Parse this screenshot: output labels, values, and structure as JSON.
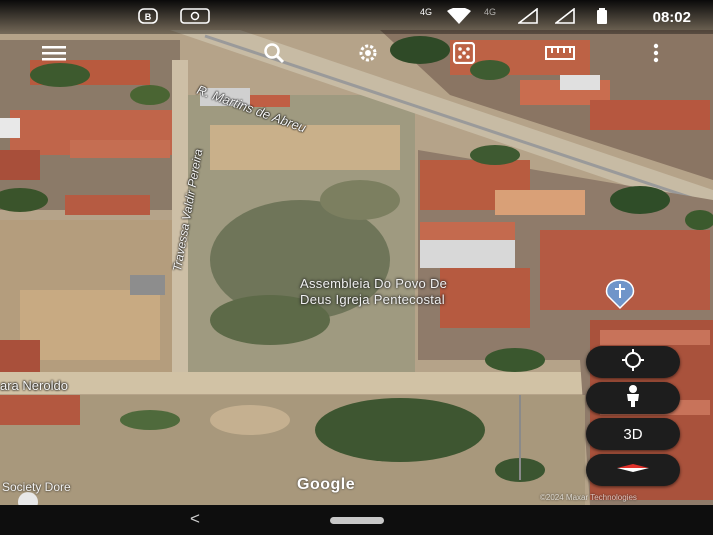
{
  "status_bar": {
    "time": "08:02",
    "network_primary": "4G",
    "network_secondary": "4G",
    "icons": [
      "notification-b-icon",
      "notification-app-icon",
      "wifi-icon",
      "signal-icon",
      "battery-icon"
    ]
  },
  "toolbar": {
    "icons": [
      "menu-icon",
      "search-icon",
      "settings-icon",
      "dice-icon",
      "ruler-icon",
      "more-icon"
    ]
  },
  "map": {
    "road_labels": {
      "diagonal": "R. Martins de Abreu",
      "vertical": "Travessa Valdir Pereira"
    },
    "poi": {
      "line1": "Assembleia Do Povo De",
      "line2": "Deus Igreja Pentecostal"
    },
    "partial_label_left": "ara Neroldo",
    "partial_label_bottom": "Society Dore",
    "attribution": "Google",
    "imagery_credit": "©2024 Maxar Technologies"
  },
  "controls": {
    "locate_icon": "crosshair-icon",
    "pegman_icon": "pegman-icon",
    "view_3d_label": "3D",
    "compass_icon": "compass-icon"
  },
  "nav_bar": {
    "back_glyph": "<"
  },
  "colors": {
    "fab_bg": "#1d1d1d",
    "poi_pin": "#6f95c9",
    "compass_red": "#e0312b"
  }
}
